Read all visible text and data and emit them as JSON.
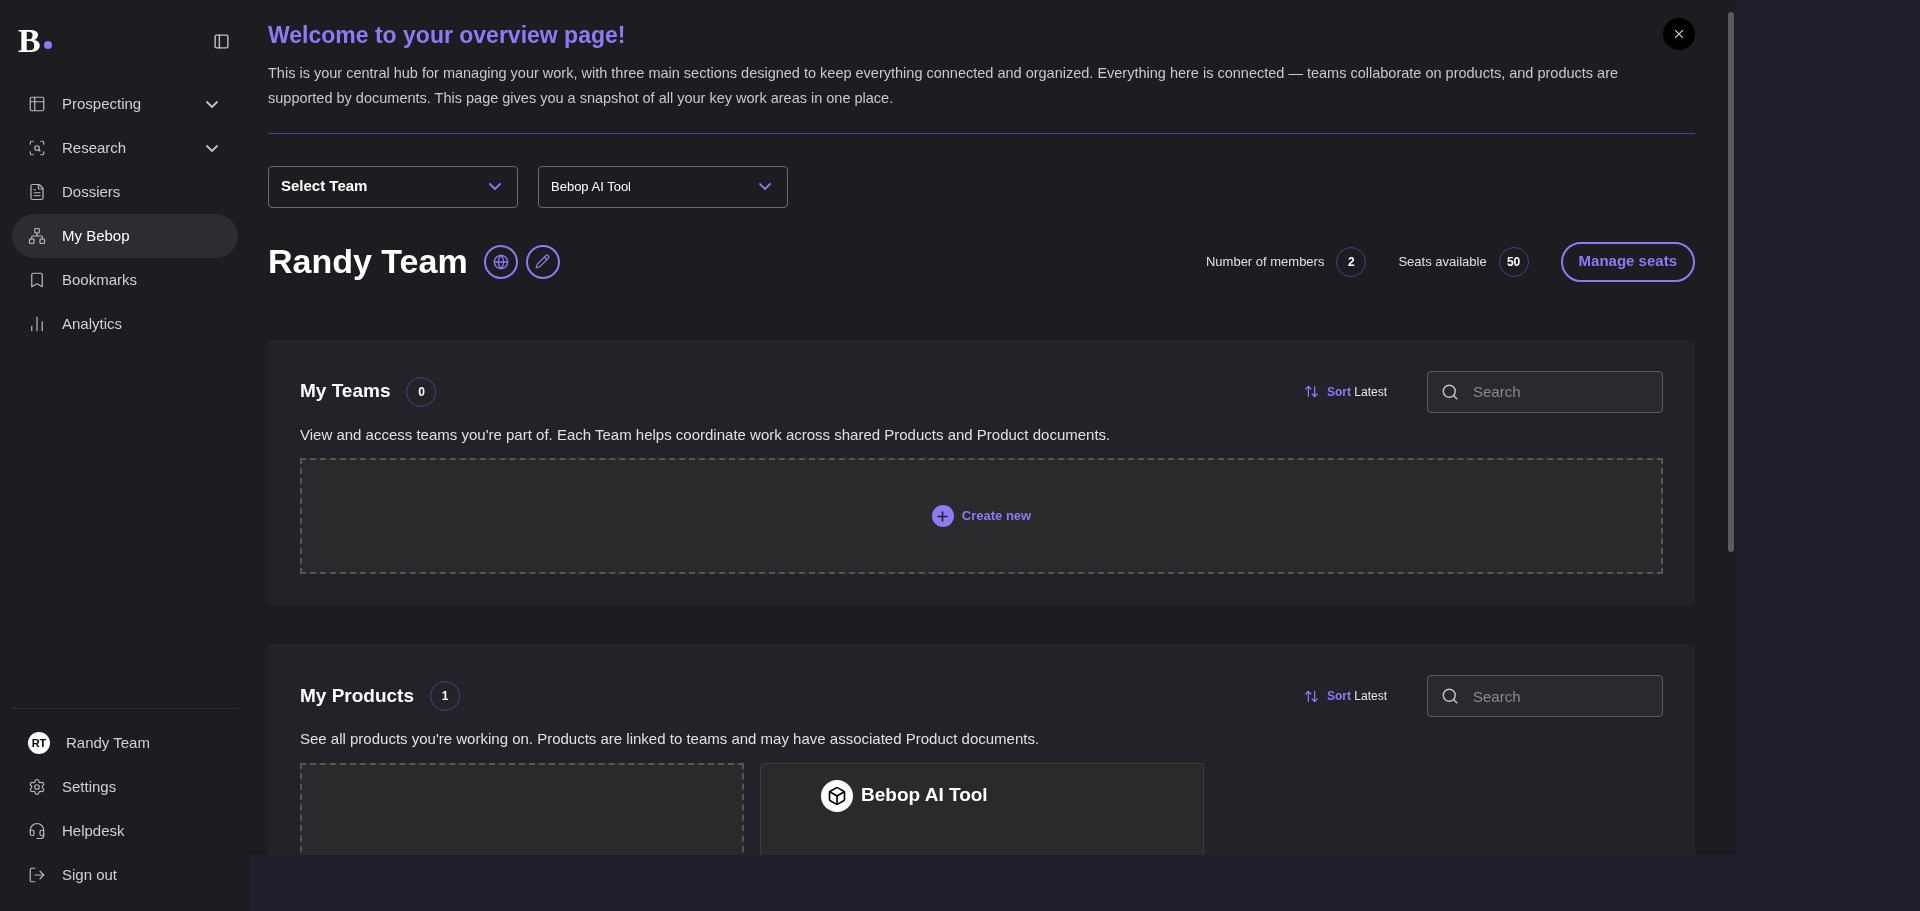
{
  "sidebar": {
    "logo": "B",
    "items": [
      {
        "label": "Prospecting",
        "expandable": true,
        "selected": false
      },
      {
        "label": "Research",
        "expandable": true,
        "selected": false
      },
      {
        "label": "Dossiers",
        "expandable": false,
        "selected": false
      },
      {
        "label": "My Bebop",
        "expandable": false,
        "selected": true
      },
      {
        "label": "Bookmarks",
        "expandable": false,
        "selected": false
      },
      {
        "label": "Analytics",
        "expandable": false,
        "selected": false
      }
    ],
    "footer": [
      {
        "label": "Randy Team",
        "kind": "avatar",
        "initials": "RT"
      },
      {
        "label": "Settings",
        "kind": "link"
      },
      {
        "label": "Helpdesk",
        "kind": "link"
      },
      {
        "label": "Sign out",
        "kind": "link"
      }
    ]
  },
  "welcome": {
    "title": "Welcome to your overview page!",
    "text": "This is your central hub for managing your work, with three main sections designed to keep everything connected and organized. Everything here is connected — teams collaborate on products, and products are supported by documents. This page gives you a snapshot of all your key work areas in one place."
  },
  "selects": [
    {
      "value": "Select Team"
    },
    {
      "value": "Bebop AI Tool"
    }
  ],
  "team": {
    "name": "Randy Team",
    "members_label": "Number of members",
    "members": "2",
    "seats_label": "Seats available",
    "seats": "50",
    "manage_button": "Manage seats"
  },
  "sections": [
    {
      "title": "My Teams",
      "count": "0",
      "sort_label": "Sort",
      "sort_value": "Latest",
      "search_placeholder": "Search",
      "description": "View and access teams you're part of. Each Team helps coordinate work across shared Products and Product documents.",
      "create_label": "Create new"
    },
    {
      "title": "My Products",
      "count": "1",
      "sort_label": "Sort",
      "sort_value": "Latest",
      "search_placeholder": "Search",
      "description": "See all products you're working on. Products are linked to teams and may have associated Product documents.",
      "cards": [
        {
          "kind": "placeholder"
        },
        {
          "kind": "product",
          "name": "Bebop AI Tool"
        }
      ]
    }
  ]
}
